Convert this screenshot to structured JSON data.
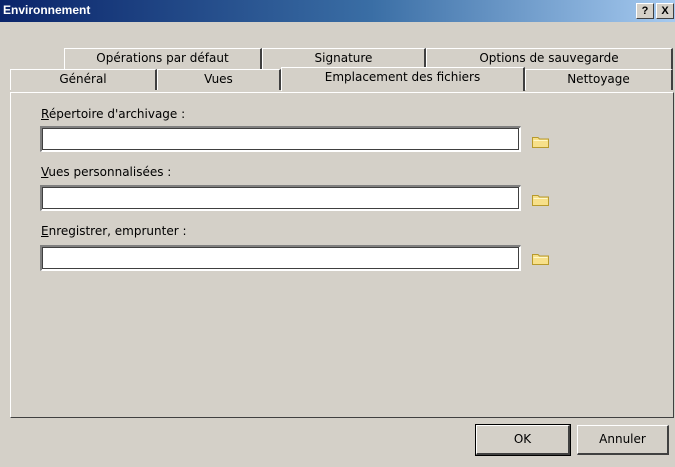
{
  "window": {
    "title": "Environnement",
    "help_label": "?",
    "close_label": "X"
  },
  "tabs": {
    "row1": [
      {
        "label": "Opérations par défaut"
      },
      {
        "label": "Signature"
      },
      {
        "label": "Options de sauvegarde"
      }
    ],
    "row2": [
      {
        "label": "Général"
      },
      {
        "label": "Vues"
      },
      {
        "label": "Emplacement des fichiers",
        "active": true
      },
      {
        "label": "Nettoyage"
      }
    ]
  },
  "fields": [
    {
      "accel": "R",
      "label_rest": "épertoire d'archivage :",
      "value": ""
    },
    {
      "accel": "V",
      "label_rest": "ues personnalisées :",
      "value": ""
    },
    {
      "accel": "E",
      "label_rest": "nregistrer, emprunter :",
      "value": ""
    }
  ],
  "icons": {
    "browse": "folder-icon"
  },
  "buttons": {
    "ok": "OK",
    "cancel": "Annuler"
  },
  "colors": {
    "titlebar_start": "#0a246a",
    "titlebar_end": "#a6caf0",
    "folder": "#f7e08a"
  }
}
